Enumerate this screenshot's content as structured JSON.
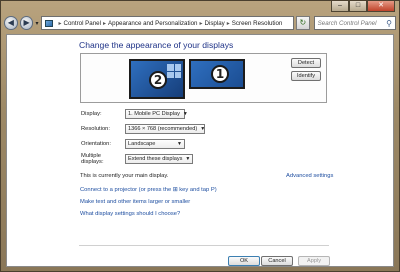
{
  "window": {
    "controls": {
      "minimize": "–",
      "maximize": "□",
      "close": "✕"
    }
  },
  "nav": {
    "back_icon": "back-arrow-icon",
    "forward_icon": "forward-arrow-icon",
    "dropdown_glyph": "▾",
    "breadcrumbs": [
      "Control Panel",
      "Appearance and Personalization",
      "Display",
      "Screen Resolution"
    ],
    "search_placeholder": "Search Control Panel"
  },
  "page": {
    "heading": "Change the appearance of your displays",
    "monitors": [
      {
        "number": "2"
      },
      {
        "number": "1"
      }
    ],
    "detect_label": "Detect",
    "identify_label": "Identify",
    "settings": [
      {
        "label": "Display:",
        "value": "1. Mobile PC Display"
      },
      {
        "label": "Resolution:",
        "value": "1366 × 768 (recommended)"
      },
      {
        "label": "Orientation:",
        "value": "Landscape"
      },
      {
        "label": "Multiple displays:",
        "value": "Extend these displays"
      }
    ],
    "main_display_text": "This is currently your main display.",
    "advanced_settings": "Advanced settings",
    "links": {
      "projector": "Connect to a projector (or press the ⊞ key and tap P)",
      "text_size": "Make text and other items larger or smaller",
      "which_settings": "What display settings should I choose?"
    },
    "buttons": {
      "ok": "OK",
      "cancel": "Cancel",
      "apply": "Apply"
    }
  }
}
